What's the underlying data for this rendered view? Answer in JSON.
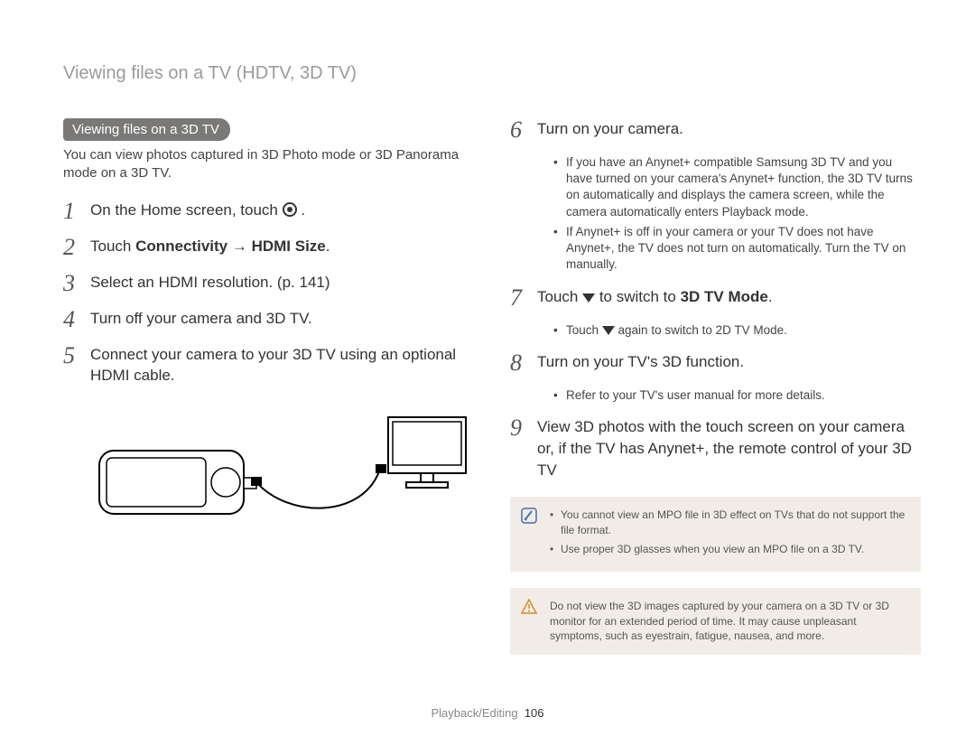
{
  "breadcrumb": "Viewing files on a TV (HDTV, 3D TV)",
  "left": {
    "pill": "Viewing files on a 3D TV",
    "intro": "You can view photos captured in 3D Photo mode or 3D Panorama mode on a 3D TV.",
    "steps": {
      "s1_pre": "On the Home screen, touch ",
      "s1_post": " .",
      "s2_pre": "Touch ",
      "s2_b1": "Connectivity",
      "s2_mid": " → ",
      "s2_b2": "HDMI Size",
      "s2_post": ".",
      "s3": "Select an HDMI resolution. (p. 141)",
      "s4": "Turn off your camera and 3D TV.",
      "s5": "Connect your camera to your 3D TV using an optional HDMI cable."
    }
  },
  "right": {
    "steps": {
      "s6": "Turn on your camera.",
      "s6_b1": "If you have an Anynet+ compatible Samsung 3D TV and you have turned on your camera's Anynet+ function, the 3D TV turns on automatically and displays the camera screen, while the camera automatically enters Playback mode.",
      "s6_b2": "If Anynet+ is off in your camera or your TV does not have Anynet+, the TV does not turn on automatically. Turn the TV on manually.",
      "s7_pre": "Touch ",
      "s7_mid": " to switch to ",
      "s7_b": "3D TV Mode",
      "s7_post": ".",
      "s7_sub_pre": "Touch ",
      "s7_sub_mid": " again to switch to ",
      "s7_sub_b": "2D TV Mode",
      "s7_sub_post": ".",
      "s8": "Turn on your TV's 3D function.",
      "s8_b1": "Refer to your TV's user manual for more details.",
      "s9": "View 3D photos with the touch screen on your camera or, if the TV has Anynet+, the remote control of your 3D TV"
    },
    "note": {
      "n1": "You cannot view an MPO file in 3D effect on TVs that do not support the file format.",
      "n2": "Use proper 3D glasses when you view an MPO file on a 3D TV."
    },
    "warn": "Do not view the 3D images captured by your camera on a 3D TV or 3D monitor for an extended period of time. It may cause unpleasant symptoms, such as eyestrain, fatigue, nausea, and more."
  },
  "footer": {
    "section": "Playback/Editing",
    "page": "106"
  }
}
